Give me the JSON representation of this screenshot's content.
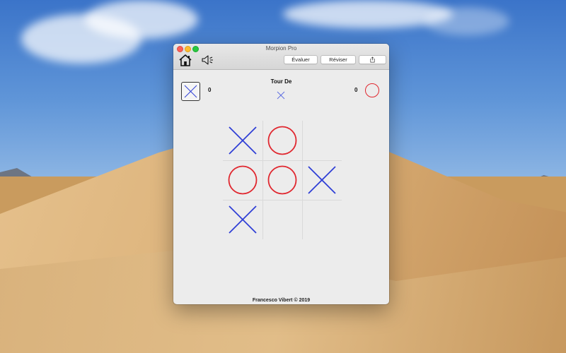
{
  "window": {
    "title": "Morpion Pro",
    "toolbar": {
      "home_icon": "home-icon",
      "sound_icon": "speaker-icon",
      "evaluate_label": "Évaluer",
      "revise_label": "Réviser",
      "share_icon": "share-icon"
    }
  },
  "game": {
    "player_x": {
      "symbol": "X",
      "score": "0",
      "color": "#2f3fd6"
    },
    "player_o": {
      "symbol": "O",
      "score": "0",
      "color": "#e0272f"
    },
    "turn_label": "Tour De",
    "current_turn": "X",
    "board": [
      [
        "X",
        "O",
        ""
      ],
      [
        "O",
        "O",
        "X"
      ],
      [
        "X",
        "",
        ""
      ]
    ]
  },
  "footer": "Francesco Vibert © 2019"
}
